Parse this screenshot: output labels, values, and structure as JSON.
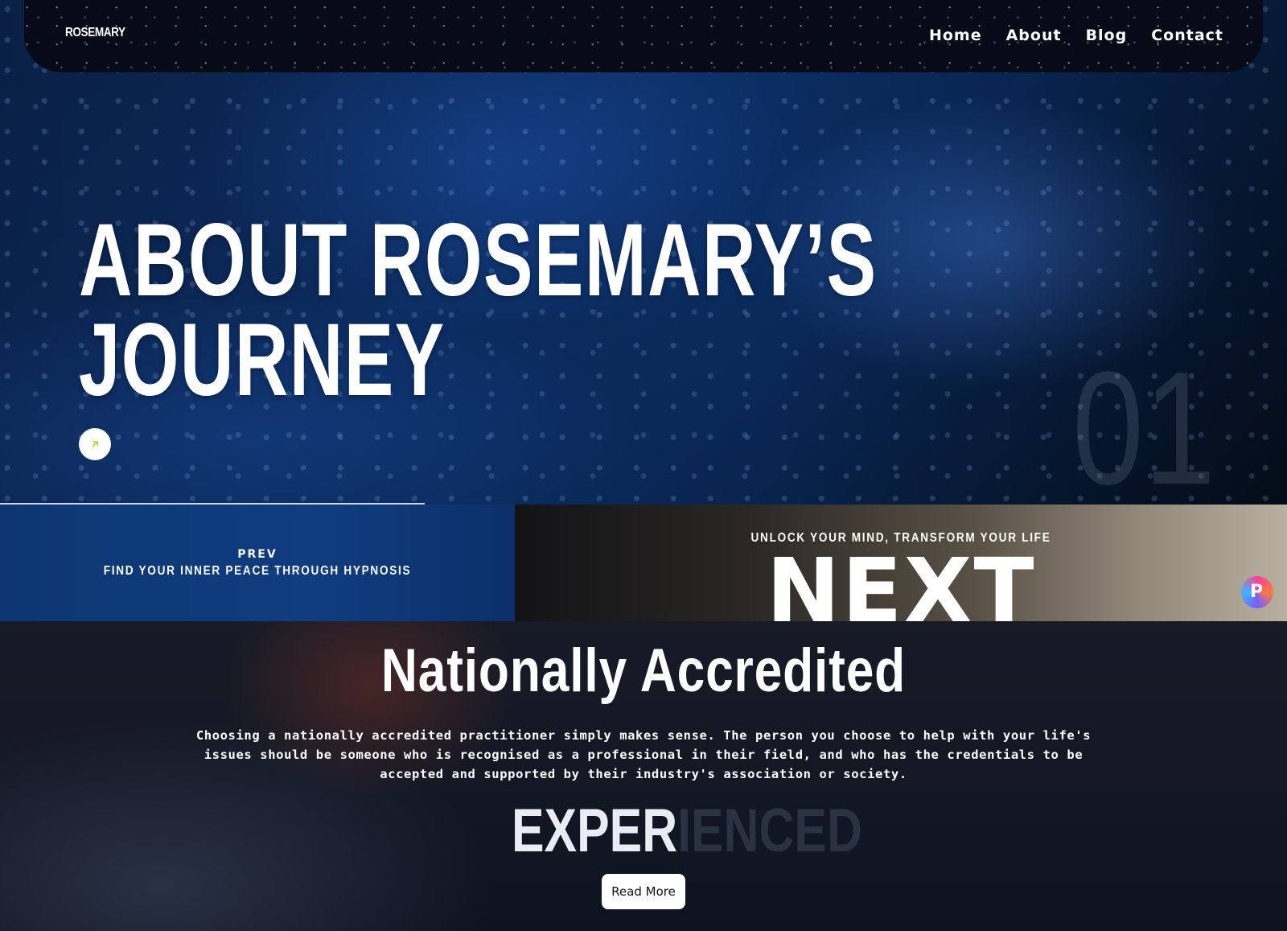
{
  "header": {
    "logo": "ROSEMARY",
    "nav": [
      {
        "label": "Home"
      },
      {
        "label": "About"
      },
      {
        "label": "Blog"
      },
      {
        "label": "Contact"
      }
    ]
  },
  "hero": {
    "title_line1": "ABOUT ROSEMARY’S",
    "title_line2": "JOURNEY",
    "slide_number": "01",
    "arrow_icon": "arrow-up-right-icon",
    "progress": 0.33
  },
  "prev": {
    "label": "PREV",
    "title": "FIND YOUR INNER PEACE THROUGH HYPNOSIS"
  },
  "next": {
    "tagline": "UNLOCK YOUR MIND, TRANSFORM YOUR LIFE",
    "label": "NEXT"
  },
  "accredited": {
    "title": "Nationally Accredited",
    "body": "Choosing a nationally accredited practitioner simply makes sense. The person you choose to help with your life's issues should be someone who is recognised as a professional in their field, and who has the credentials to be accepted and supported by their industry's association or society.",
    "word_solid": "EXPER",
    "word_faded": "IENCED",
    "button": "Read More"
  },
  "colors": {
    "accent": "#a7d32a",
    "nav_bg": "#070b18"
  },
  "widget": {
    "icon": "pro-badge-icon",
    "letter": "P"
  }
}
